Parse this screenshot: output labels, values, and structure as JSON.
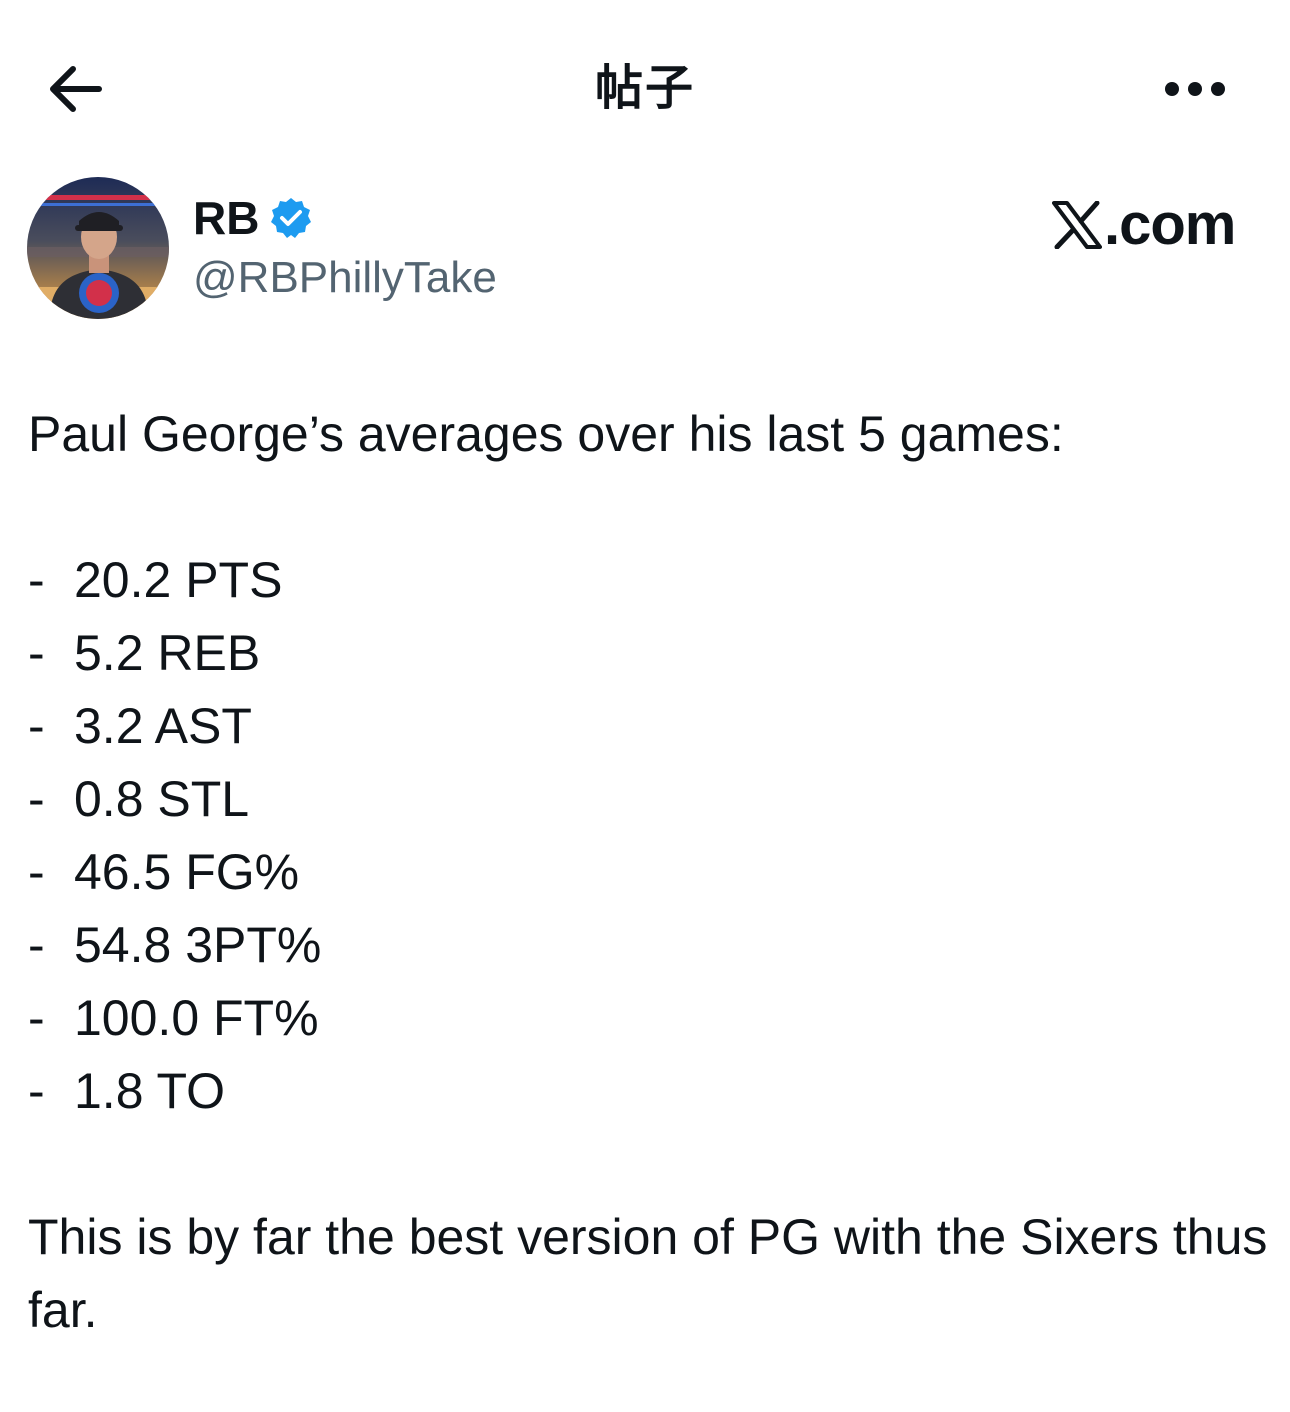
{
  "nav": {
    "title": "帖子"
  },
  "author": {
    "name": "RB",
    "handle": "@RBPhillyTake",
    "verified": true
  },
  "brand": {
    "text": ".com"
  },
  "post": {
    "intro": "Paul George’s averages over his last 5 games:",
    "bullet": "-",
    "stats": [
      "20.2 PTS",
      "5.2 REB",
      "3.2 AST",
      "0.8 STL",
      "46.5 FG%",
      "54.8 3PT%",
      "100.0 FT%",
      "1.8 TO"
    ],
    "closing": "This is by far the best version of PG with the Sixers thus far."
  },
  "colors": {
    "text": "#0f1419",
    "secondary": "#536471",
    "verified": "#1d9bf0",
    "background": "#ffffff"
  },
  "icons": {
    "back": "arrow-left-icon",
    "more": "more-horizontal-icon",
    "verified": "verified-badge-icon",
    "brand": "x-logo-icon"
  }
}
